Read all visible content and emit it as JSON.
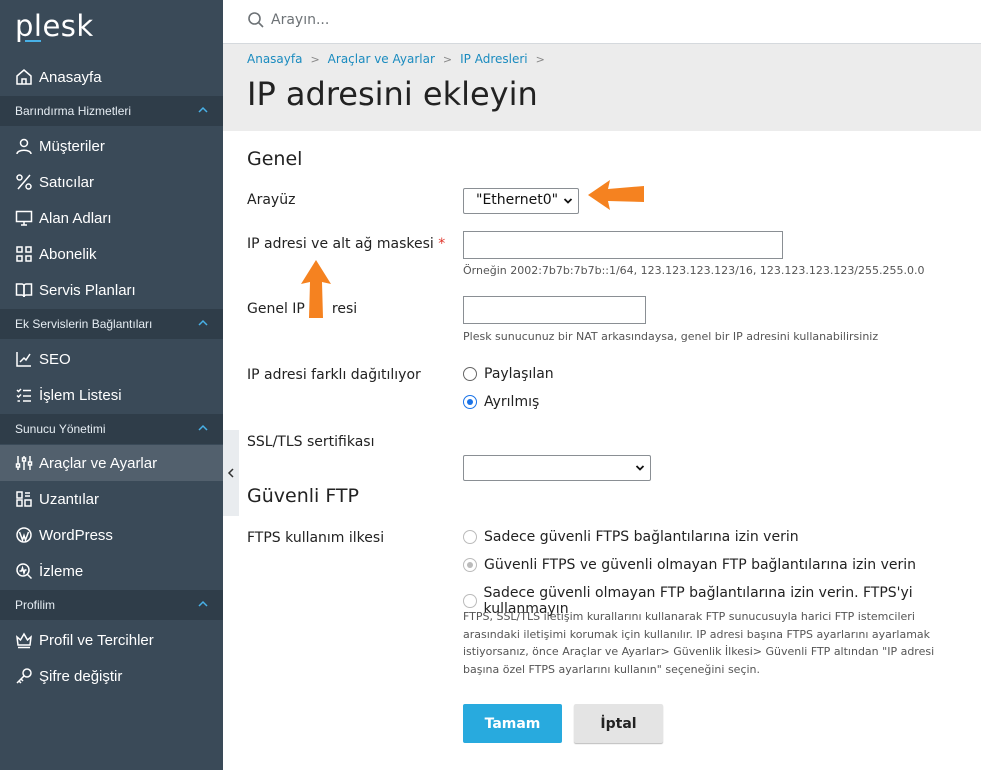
{
  "brand": {
    "logo": "plesk"
  },
  "search": {
    "placeholder": "Arayın..."
  },
  "sidebar": {
    "home": "Anasayfa",
    "sections": [
      {
        "title": "Barındırma Hizmetleri"
      },
      {
        "title": "Ek Servislerin Bağlantıları"
      },
      {
        "title": "Sunucu Yönetimi"
      },
      {
        "title": "Profilim"
      }
    ],
    "items": [
      {
        "label": "Müşteriler",
        "icon": "user-icon"
      },
      {
        "label": "Satıcılar",
        "icon": "percent-icon"
      },
      {
        "label": "Alan Adları",
        "icon": "monitor-icon"
      },
      {
        "label": "Abonelik",
        "icon": "grid-icon"
      },
      {
        "label": "Servis Planları",
        "icon": "book-icon"
      },
      {
        "label": "SEO",
        "icon": "chart-icon"
      },
      {
        "label": "İşlem Listesi",
        "icon": "checklist-icon"
      },
      {
        "label": "Araçlar ve Ayarlar",
        "icon": "sliders-icon"
      },
      {
        "label": "Uzantılar",
        "icon": "extensions-icon"
      },
      {
        "label": "WordPress",
        "icon": "wordpress-icon"
      },
      {
        "label": "İzleme",
        "icon": "monitoring-icon"
      },
      {
        "label": "Profil ve Tercihler",
        "icon": "crown-icon"
      },
      {
        "label": "Şifre değiştir",
        "icon": "key-icon"
      }
    ]
  },
  "breadcrumb": [
    "Anasayfa",
    "Araçlar ve Ayarlar",
    "IP Adresleri"
  ],
  "page": {
    "title": "IP adresini ekleyin"
  },
  "general": {
    "heading": "Genel",
    "interface_label": "Arayüz",
    "interface_value": "\"Ethernet0\"",
    "ip_mask_label": "IP adresi ve alt ağ maskesi",
    "required_mark": "*",
    "ip_mask_value": "",
    "ip_mask_hint": "Örneğin 2002:7b7b:7b7b::1/64, 123.123.123.123/16, 123.123.123.123/255.255.0.0",
    "public_ip_label_a": "Genel IP a",
    "public_ip_label_b": "resi",
    "public_ip_value": "",
    "public_ip_hint": "Plesk sunucunuz bir NAT arkasındaysa, genel bir IP adresini kullanabilirsiniz",
    "distribution_label": "IP adresi farklı dağıtılıyor",
    "distribution_options": [
      "Paylaşılan",
      "Ayrılmış"
    ],
    "distribution_selected": "Ayrılmış",
    "ssl_label": "SSL/TLS sertifikası",
    "ssl_value": ""
  },
  "ftp": {
    "heading": "Güvenli FTP",
    "policy_label": "FTPS kullanım ilkesi",
    "options": [
      "Sadece güvenli FTPS bağlantılarına izin verin",
      "Güvenli FTPS ve güvenli olmayan FTP bağlantılarına izin verin",
      "Sadece güvenli olmayan FTP bağlantılarına izin verin. FTPS'yi kullanmayın"
    ],
    "selected": "Güvenli FTPS ve güvenli olmayan FTP bağlantılarına izin verin",
    "description_lines": [
      "FTPS, SSL/TLS iletişim kurallarını kullanarak FTP sunucusuyla harici FTP istemcileri",
      "arasındaki iletişimi korumak için kullanılır. IP adresi başına FTPS ayarlarını ayarlamak",
      "istiyorsanız, önce Araçlar ve Ayarlar> Güvenlik İlkesi> Güvenli FTP altından \"IP adresi",
      "başına özel FTPS ayarlarını kullanın\" seçeneğini seçin."
    ]
  },
  "actions": {
    "ok": "Tamam",
    "cancel": "İptal"
  },
  "colors": {
    "sidebar": "#3a4a58",
    "sidebar_section": "#2f3d49",
    "accent": "#28aade",
    "arrow": "#f58220"
  }
}
